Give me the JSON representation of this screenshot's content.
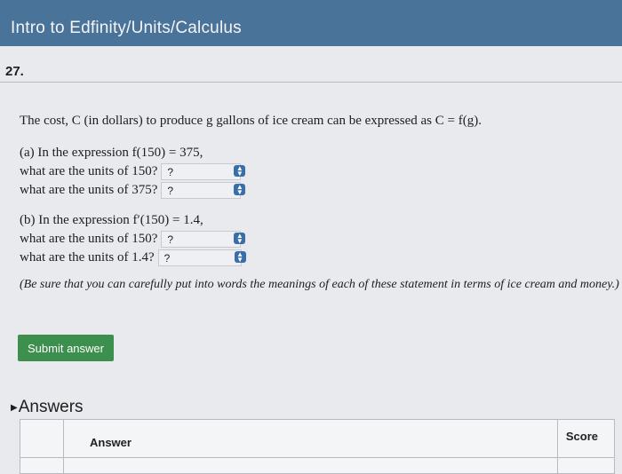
{
  "header": {
    "title": "Intro to Edfinity/Units/Calculus"
  },
  "question": {
    "number": "27.",
    "statement": "The cost, C (in dollars) to produce g gallons of ice cream can be expressed as C = f(g).",
    "part_a": {
      "intro": "(a) In the expression f(150) = 375,",
      "q1": {
        "text": "what are the units of 150?",
        "value": "?"
      },
      "q2": {
        "text": "what are the units of 375?",
        "value": "?"
      }
    },
    "part_b": {
      "intro": "(b) In the expression f′(150) = 1.4,",
      "q1": {
        "text": "what are the units of 150?",
        "value": "?"
      },
      "q2": {
        "text": "what are the units of 1.4?",
        "value": "?"
      }
    },
    "note": "(Be sure that you can carefully put into words the meanings of each of these statement in terms of ice cream and money.)"
  },
  "submit_label": "Submit answer",
  "answers": {
    "title": "Answers",
    "columns": {
      "answer": "Answer",
      "score": "Score"
    }
  }
}
